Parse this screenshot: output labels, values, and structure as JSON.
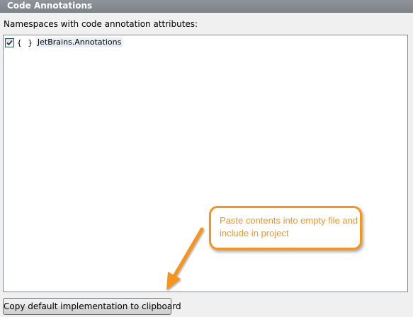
{
  "header": {
    "title": "Code Annotations"
  },
  "caption": "Namespaces with code annotation attributes:",
  "namespaces": [
    {
      "icon": "namespace-icon",
      "icon_glyph": "{ }",
      "label": "JetBrains.Annotations",
      "checked": true
    }
  ],
  "buttons": {
    "copy_label": "Copy default implementation to clipboard"
  },
  "callout": {
    "text": "Paste contents into empty file and include in project",
    "color": "#f7941d"
  },
  "colors": {
    "header_bg": "#858b91",
    "accent_orange": "#f7941d"
  }
}
